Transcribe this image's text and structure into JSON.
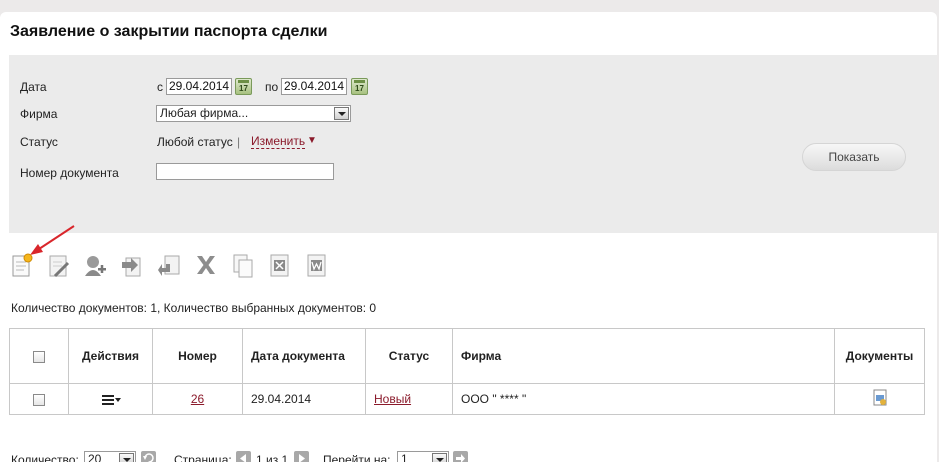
{
  "page_title": "Заявление о закрытии паспорта сделки",
  "filters": {
    "date_label": "Дата",
    "date_from_prefix": "с",
    "date_from": "29.04.2014",
    "date_to_prefix": "по",
    "date_to": "29.04.2014",
    "calendar_day": "17",
    "firm_label": "Фирма",
    "firm_value": "Любая фирма...",
    "status_label": "Статус",
    "status_value": "Любой статус",
    "status_separator": "|",
    "status_change": "Изменить",
    "doc_number_label": "Номер документа",
    "doc_number_value": "",
    "show_button": "Показать"
  },
  "toolbar": {
    "icons": [
      "new-document-icon",
      "edit-document-icon",
      "sign-icon",
      "send-icon",
      "import-icon",
      "delete-icon",
      "copy-icon",
      "export-excel-icon",
      "export-word-icon"
    ]
  },
  "summary": "Количество документов: 1, Количество выбранных документов: 0",
  "table": {
    "headers": [
      "",
      "Действия",
      "Номер",
      "Дата документа",
      "Статус",
      "Фирма",
      "Документы"
    ],
    "rows": [
      {
        "number": "26",
        "date": "29.04.2014",
        "status": "Новый",
        "firm": "ООО \" **** \""
      }
    ]
  },
  "pager": {
    "count_label": "Количество:",
    "count_value": "20",
    "page_label": "Страница:",
    "page_info": "1 из 1",
    "goto_label": "Перейти на:",
    "goto_value": "1"
  },
  "colors": {
    "link": "#8b1a2b",
    "panel": "#ebebeb",
    "annotation_arrow": "#d9262b"
  }
}
